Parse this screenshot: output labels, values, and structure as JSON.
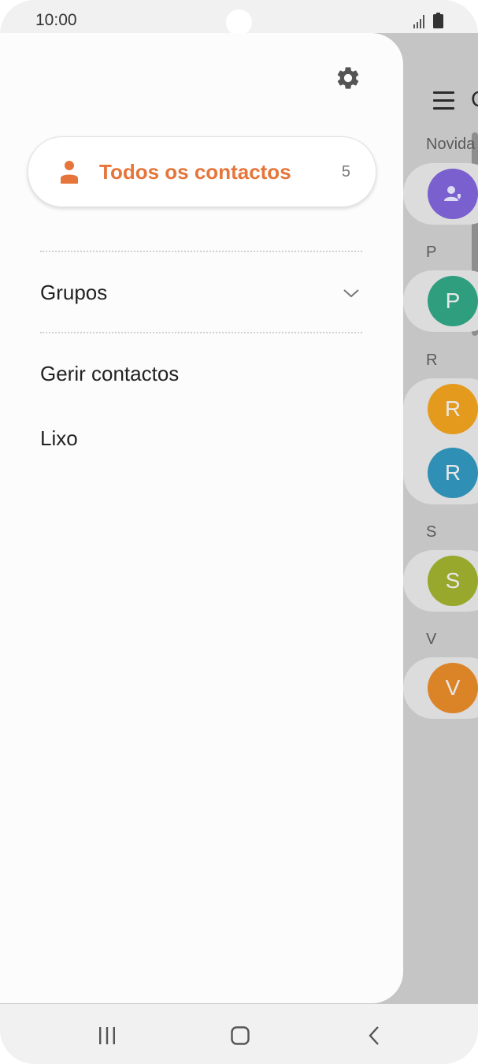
{
  "status_bar": {
    "time": "10:00"
  },
  "drawer": {
    "all_contacts": {
      "label": "Todos os contactos",
      "count": "5"
    },
    "groups_label": "Grupos",
    "manage_label": "Gerir contactos",
    "trash_label": "Lixo"
  },
  "background_list": {
    "title_partial": "C",
    "sections": [
      "Novida",
      "P",
      "R",
      "S",
      "V"
    ],
    "avatars": [
      "P",
      "R",
      "R",
      "S",
      "V"
    ]
  },
  "colors": {
    "accent": "#e5753a",
    "avatar_p": "#2f9e7f",
    "avatar_r1": "#e49a1d",
    "avatar_r2": "#2f8fb4",
    "avatar_s": "#97a82d",
    "avatar_v": "#db8327",
    "avatar_new": "#7a5fcf"
  },
  "icons": [
    "settings-icon",
    "person-icon",
    "chevron-down-icon",
    "menu-icon",
    "recent-apps-icon",
    "home-icon",
    "back-icon",
    "signal-icon",
    "battery-icon"
  ]
}
